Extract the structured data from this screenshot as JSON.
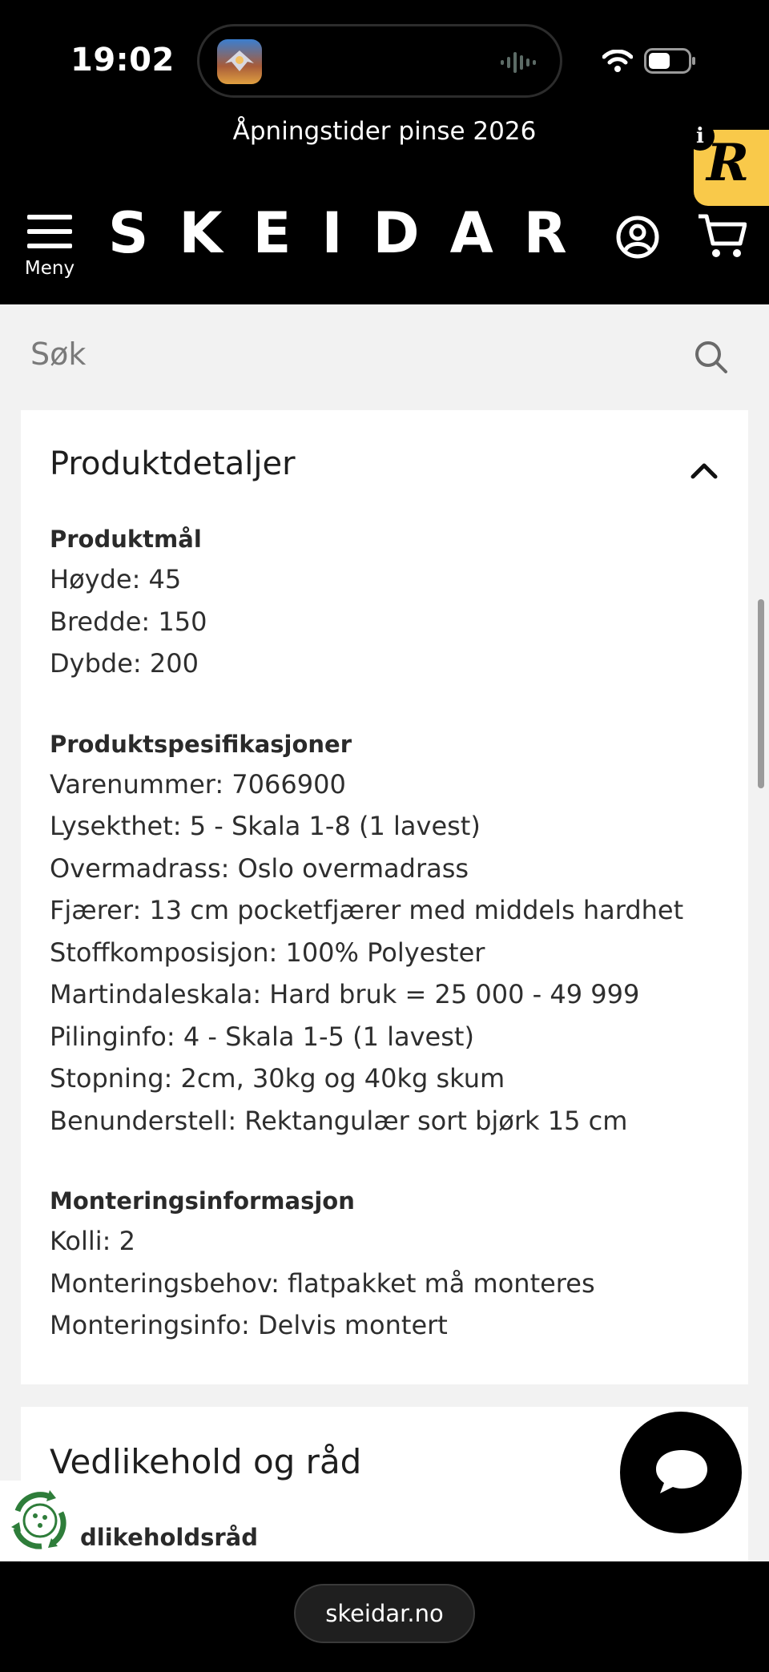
{
  "status_bar": {
    "time": "19:02"
  },
  "header": {
    "announcement": "Åpningstider pinse 2026",
    "logo": "SKEIDAR",
    "menu_label": "Meny",
    "badge_letter": "R",
    "info_glyph": "i"
  },
  "search": {
    "placeholder": "Søk"
  },
  "product_details": {
    "title": "Produktdetaljer",
    "sections": [
      {
        "title": "Produktmål",
        "lines": [
          "Høyde: 45",
          "Bredde: 150",
          "Dybde: 200"
        ]
      },
      {
        "title": "Produktspesifikasjoner",
        "lines": [
          "Varenummer: 7066900",
          "Lysekthet: 5 - Skala 1-8 (1 lavest)",
          "Overmadrass: Oslo overmadrass",
          "Fjærer: 13 cm pocketfjærer med middels hardhet",
          "Stoffkomposisjon: 100% Polyester",
          "Martindaleskala: Hard bruk = 25 000 - 49 999",
          "Pilinginfo: 4 - Skala 1-5 (1 lavest)",
          "Stopning: 2cm, 30kg og 40kg skum",
          "Benunderstell: Rektangulær sort bjørk 15 cm"
        ]
      },
      {
        "title": "Monteringsinformasjon",
        "lines": [
          "Kolli: 2",
          "Monteringsbehov: flatpakket må monteres",
          "Monteringsinfo: Delvis montert"
        ]
      }
    ]
  },
  "maintenance": {
    "title": "Vedlikehold og råd",
    "subtitle": "dlikeholdsråd"
  },
  "browser": {
    "url": "skeidar.no"
  },
  "icons": {
    "menu": "hamburger-icon",
    "user": "user-circle-icon",
    "cart": "cart-icon",
    "search": "search-icon",
    "collapse": "chevron-up-icon",
    "chat": "chat-bubble-icon",
    "recycle": "recycle-icon"
  }
}
